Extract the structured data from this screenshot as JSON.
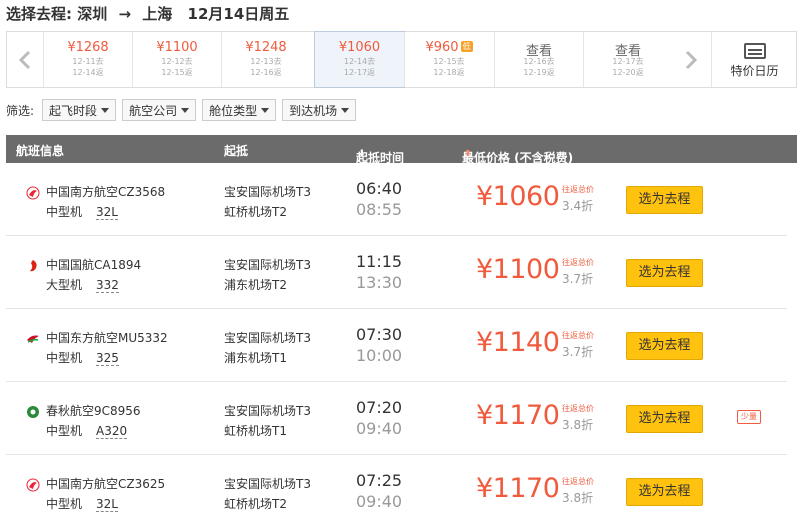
{
  "title": {
    "prefix": "选择去程:",
    "from": "深圳",
    "arrow": "→",
    "to": "上海",
    "date": "12月14日周五"
  },
  "date_strip": [
    {
      "price": "¥1268",
      "go": "12-11去",
      "back": "12-14返",
      "active": false
    },
    {
      "price": "¥1100",
      "go": "12-12去",
      "back": "12-15返",
      "active": false
    },
    {
      "price": "¥1248",
      "go": "12-13去",
      "back": "12-16返",
      "active": false
    },
    {
      "price": "¥1060",
      "go": "12-14去",
      "back": "12-17返",
      "active": true
    },
    {
      "price": "¥960",
      "go": "12-15去",
      "back": "12-18返",
      "active": false,
      "tag": "低"
    },
    {
      "price": "查看",
      "go": "12-16去",
      "back": "12-19返",
      "active": false
    },
    {
      "price": "查看",
      "go": "12-17去",
      "back": "12-20返",
      "active": false
    }
  ],
  "calendar_label": "特价日历",
  "filters": {
    "label": "筛选:",
    "items": [
      "起飞时段",
      "航空公司",
      "舱位类型",
      "到达机场"
    ]
  },
  "table_header": {
    "flight": "航班信息",
    "route": "起抵",
    "time": "起抵时间",
    "price": "最低价格 (不含税费)"
  },
  "colors": {
    "price": "#f05b3d",
    "button": "#ffc20e",
    "header_bg": "#6b6b6b"
  },
  "flights": [
    {
      "logo": "china-southern-logo-icon",
      "airline": "中国南方航空CZ3568",
      "size": "中型机",
      "model": "32L",
      "dep_ap": "宝安国际机场T3",
      "arr_ap": "虹桥机场T2",
      "dep_t": "06:40",
      "arr_t": "08:55",
      "price": "¥1060",
      "rt": "往返总价",
      "disc": "3.4折",
      "btn": "选为去程",
      "badge": ""
    },
    {
      "logo": "air-china-logo-icon",
      "airline": "中国国航CA1894",
      "size": "大型机",
      "model": "332",
      "dep_ap": "宝安国际机场T3",
      "arr_ap": "浦东机场T2",
      "dep_t": "11:15",
      "arr_t": "13:30",
      "price": "¥1100",
      "rt": "往返总价",
      "disc": "3.7折",
      "btn": "选为去程",
      "badge": ""
    },
    {
      "logo": "china-eastern-logo-icon",
      "airline": "中国东方航空MU5332",
      "size": "中型机",
      "model": "325",
      "dep_ap": "宝安国际机场T3",
      "arr_ap": "浦东机场T1",
      "dep_t": "07:30",
      "arr_t": "10:00",
      "price": "¥1140",
      "rt": "往返总价",
      "disc": "3.7折",
      "btn": "选为去程",
      "badge": ""
    },
    {
      "logo": "spring-airlines-logo-icon",
      "airline": "春秋航空9C8956",
      "size": "中型机",
      "model": "A320",
      "dep_ap": "宝安国际机场T3",
      "arr_ap": "虹桥机场T1",
      "dep_t": "07:20",
      "arr_t": "09:40",
      "price": "¥1170",
      "rt": "往返总价",
      "disc": "3.8折",
      "btn": "选为去程",
      "badge": "少量"
    },
    {
      "logo": "china-southern-logo-icon",
      "airline": "中国南方航空CZ3625",
      "size": "中型机",
      "model": "32L",
      "dep_ap": "宝安国际机场T3",
      "arr_ap": "虹桥机场T2",
      "dep_t": "07:25",
      "arr_t": "09:40",
      "price": "¥1170",
      "rt": "往返总价",
      "disc": "3.8折",
      "btn": "选为去程",
      "badge": ""
    }
  ]
}
